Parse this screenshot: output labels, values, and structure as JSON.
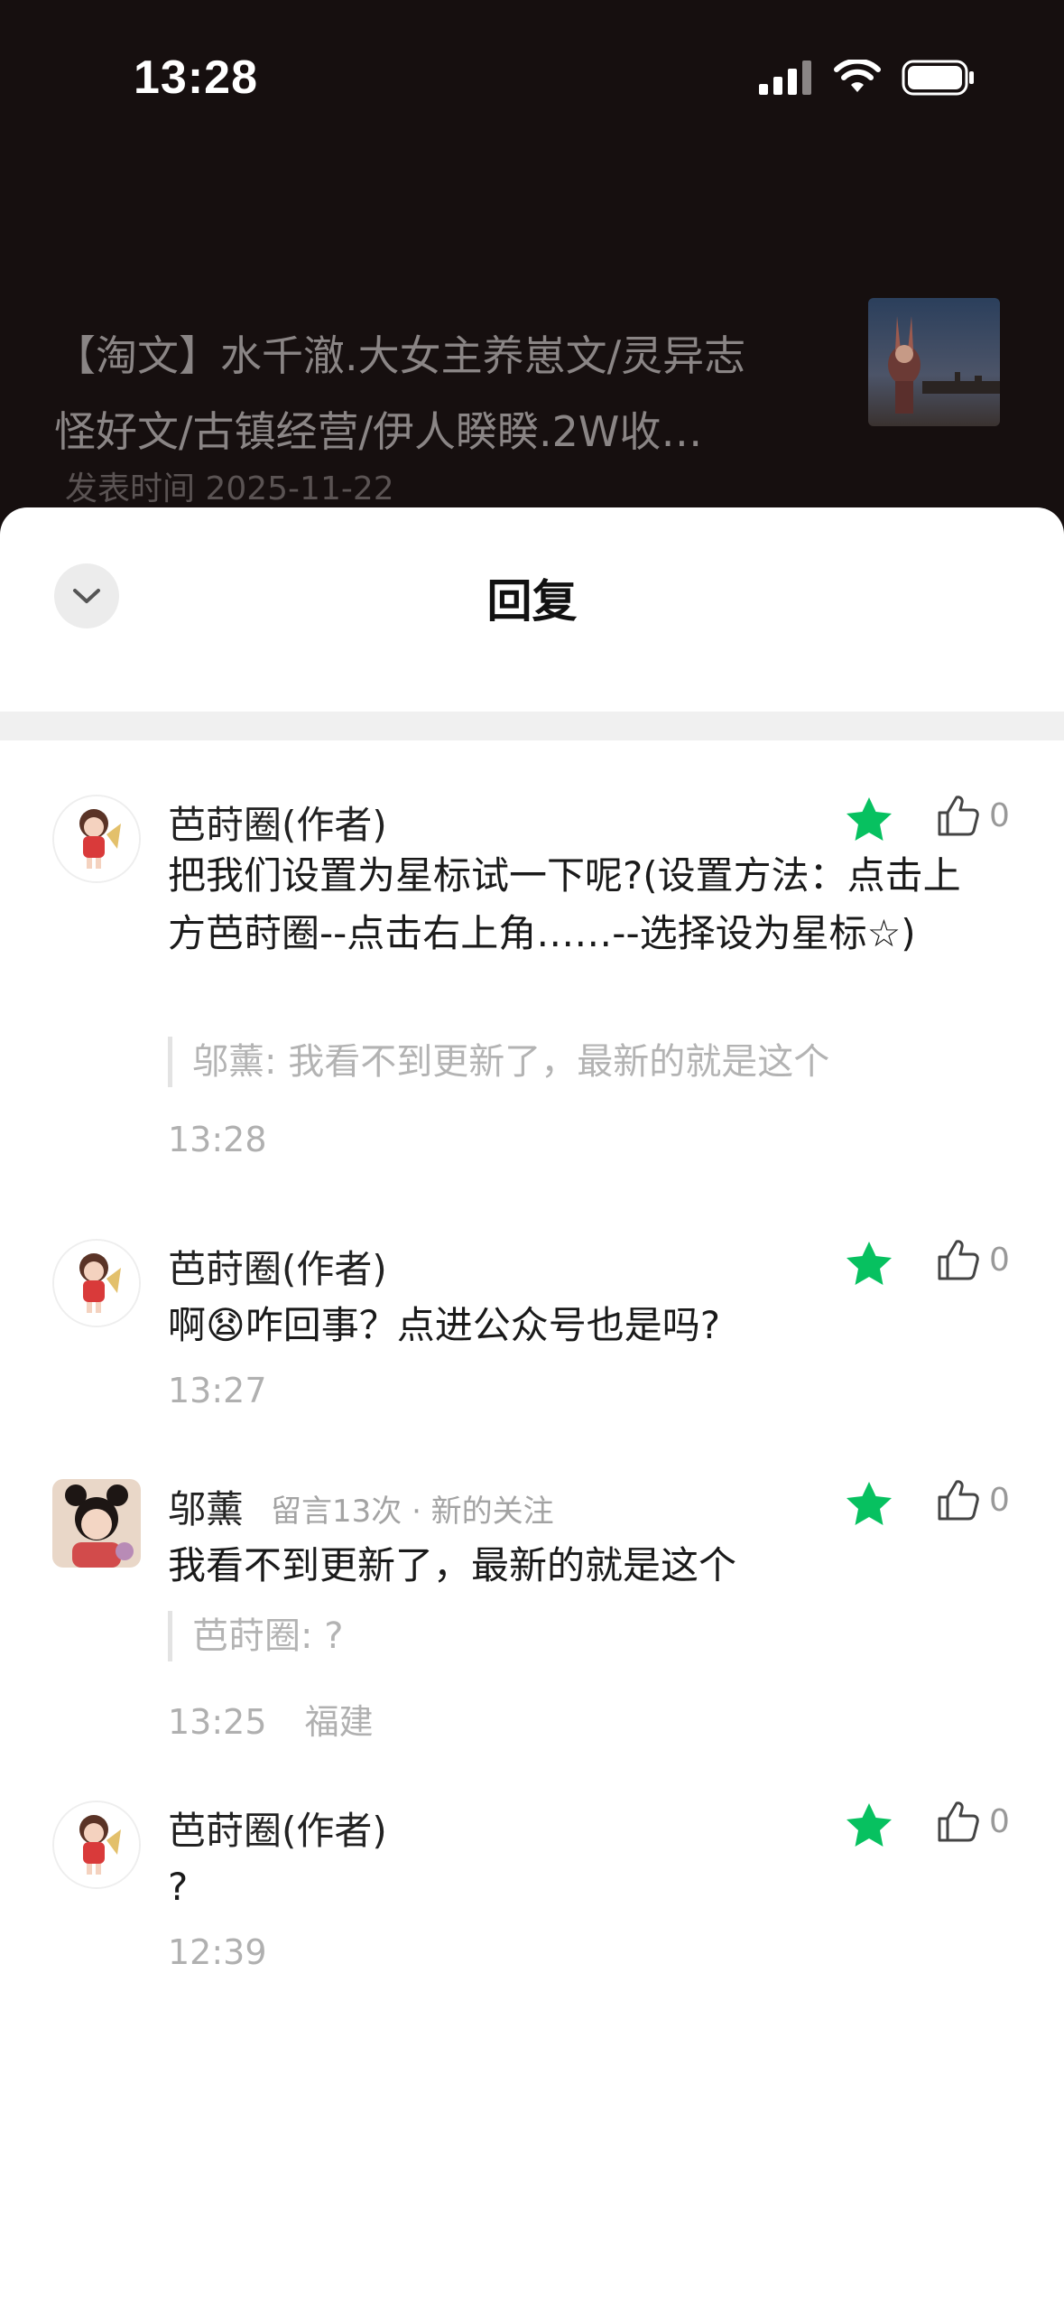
{
  "status_bar": {
    "time": "13:28"
  },
  "article": {
    "title": "【淘文】水千澈.大女主养崽文/灵异志\n怪好文/古镇经营/伊人睽睽.2W收…",
    "date": "发表时间 2025-11-22"
  },
  "sheet": {
    "title": "回复"
  },
  "comments": [
    {
      "name": "芭莳圈(作者)",
      "meta": "",
      "text": "把我们设置为星标试一下呢?(设置方法：点击上方芭莳圈--点击右上角……--选择设为星标☆)",
      "quote": "邬薰: 我看不到更新了，最新的就是这个",
      "time": "13:28",
      "location": "",
      "likes": "0"
    },
    {
      "name": "芭莳圈(作者)",
      "meta": "",
      "text": "啊😧咋回事？点进公众号也是吗?",
      "quote": "",
      "time": "13:27",
      "location": "",
      "likes": "0"
    },
    {
      "name": "邬薰",
      "meta": "留言13次 · 新的关注",
      "text": "我看不到更新了，最新的就是这个",
      "quote": "芭莳圈: ?",
      "time": "13:25",
      "location": "福建",
      "likes": "0"
    },
    {
      "name": "芭莳圈(作者)",
      "meta": "",
      "text": "?",
      "quote": "",
      "time": "12:39",
      "location": "",
      "likes": "0"
    }
  ],
  "colors": {
    "star": "#07c160",
    "sheet_bg": "#ffffff",
    "page_bg": "#160f0f"
  },
  "icons": [
    "signal-icon",
    "wifi-icon",
    "battery-icon",
    "chevron-down-icon",
    "star-icon",
    "thumbs-up-icon"
  ]
}
